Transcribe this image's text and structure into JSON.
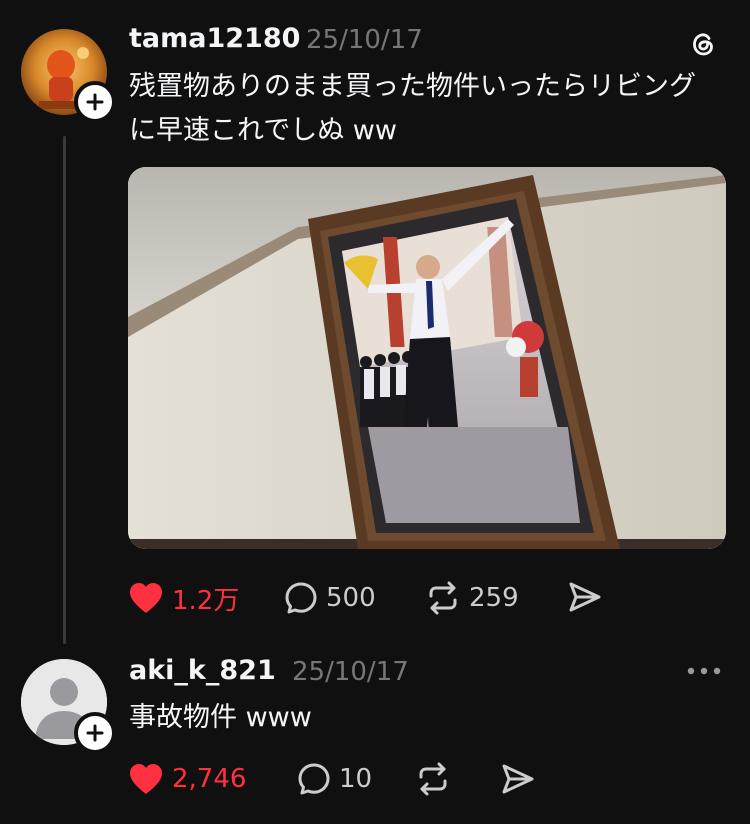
{
  "colors": {
    "background": "#101010",
    "text": "#f3f5f7",
    "muted": "#777777",
    "like_red": "#ff3040"
  },
  "post": {
    "username": "tama12180",
    "date": "25/10/17",
    "text_line1": "残置物ありのまま買った物件いったらリビング",
    "text_line2": "に早速これでしぬ ww",
    "avatar_icon": "orange-figure-avatar",
    "has_media": true,
    "actions": {
      "likes": "1.2万",
      "comments": "500",
      "reposts": "259"
    }
  },
  "reply": {
    "username": "aki_k_821",
    "date": "25/10/17",
    "text": "事故物件 www",
    "avatar_icon": "default-user-avatar",
    "actions": {
      "likes": "2,746",
      "comments": "10"
    }
  }
}
